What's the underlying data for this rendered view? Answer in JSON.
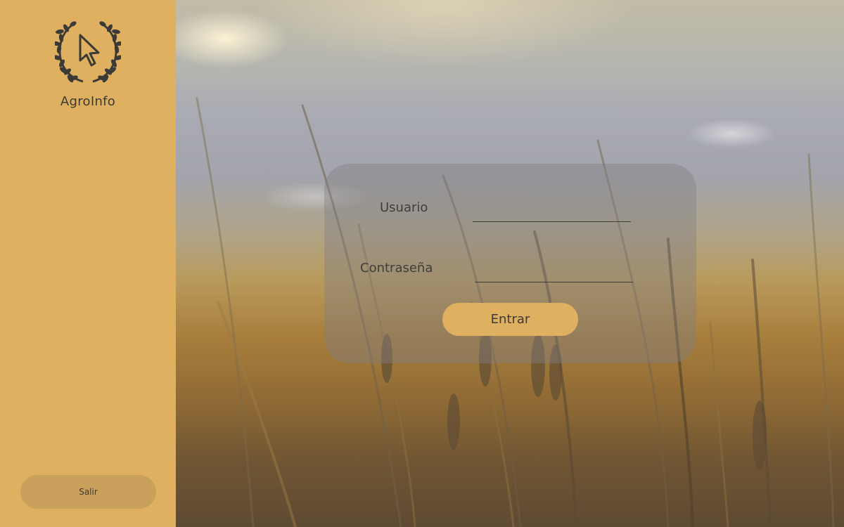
{
  "sidebar": {
    "logo_icon": "laurel-cursor-icon",
    "brand": "AgroInfo",
    "exit_label": "Salir",
    "background_color": "#deb060",
    "exit_button_color": "#c9a15c"
  },
  "scene": {
    "background": "wheat-field-photo"
  },
  "login": {
    "user_label": "Usuario",
    "user_value": "",
    "password_label": "Contraseña",
    "password_value": "",
    "submit_label": "Entrar",
    "submit_color": "#deb060"
  }
}
